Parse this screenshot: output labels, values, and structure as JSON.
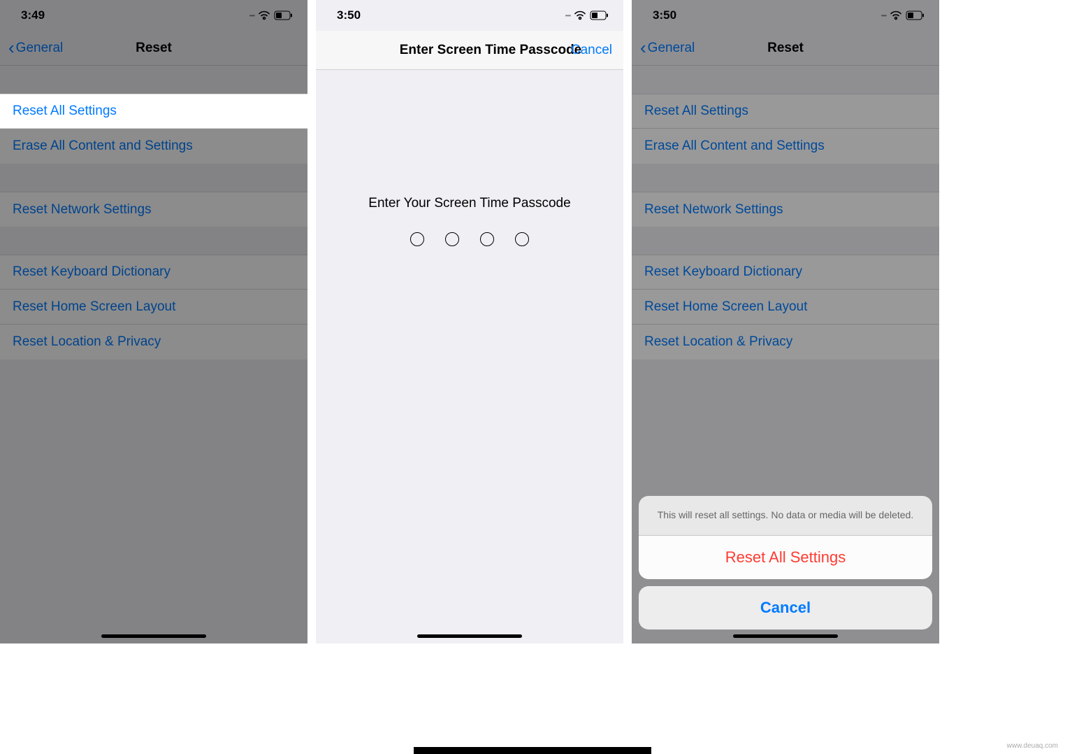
{
  "phone1": {
    "time": "3:49",
    "back_label": "General",
    "title": "Reset",
    "rows": {
      "reset_all": "Reset All Settings",
      "erase_all": "Erase All Content and Settings",
      "reset_network": "Reset Network Settings",
      "reset_keyboard": "Reset Keyboard Dictionary",
      "reset_home": "Reset Home Screen Layout",
      "reset_location": "Reset Location & Privacy"
    }
  },
  "phone2": {
    "time": "3:50",
    "title": "Enter Screen Time Passcode",
    "cancel": "Cancel",
    "prompt": "Enter Your Screen Time Passcode"
  },
  "phone3": {
    "time": "3:50",
    "back_label": "General",
    "title": "Reset",
    "rows": {
      "reset_all": "Reset All Settings",
      "erase_all": "Erase All Content and Settings",
      "reset_network": "Reset Network Settings",
      "reset_keyboard": "Reset Keyboard Dictionary",
      "reset_home": "Reset Home Screen Layout",
      "reset_location": "Reset Location & Privacy"
    },
    "sheet_message": "This will reset all settings. No data or media will be deleted.",
    "sheet_action": "Reset All Settings",
    "sheet_cancel": "Cancel"
  },
  "watermark": "www.deuaq.com"
}
